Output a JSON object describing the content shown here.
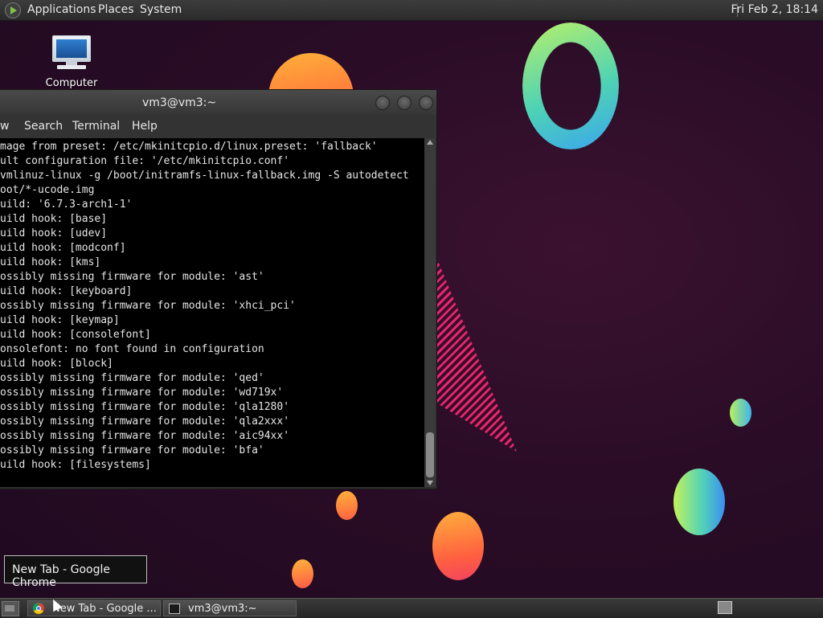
{
  "top_panel": {
    "menu": [
      "Applications",
      "Places",
      "System"
    ],
    "clock": "Fri Feb  2, 18:14"
  },
  "desktop": {
    "icons": [
      {
        "label": "Computer",
        "icon": "computer-monitor-icon"
      }
    ]
  },
  "terminal": {
    "title": "vm3@vm3:~",
    "menu": [
      "w",
      "Search",
      "Terminal",
      "Help"
    ],
    "lines": [
      "mage from preset: /etc/mkinitcpio.d/linux.preset: 'fallback'",
      "ult configuration file: '/etc/mkinitcpio.conf'",
      "vmlinuz-linux -g /boot/initramfs-linux-fallback.img -S autodetect",
      "oot/*-ucode.img",
      "uild: '6.7.3-arch1-1'",
      "uild hook: [base]",
      "uild hook: [udev]",
      "uild hook: [modconf]",
      "uild hook: [kms]",
      "ossibly missing firmware for module: 'ast'",
      "uild hook: [keyboard]",
      "ossibly missing firmware for module: 'xhci_pci'",
      "uild hook: [keymap]",
      "uild hook: [consolefont]",
      "onsolefont: no font found in configuration",
      "uild hook: [block]",
      "ossibly missing firmware for module: 'qed'",
      "ossibly missing firmware for module: 'wd719x'",
      "ossibly missing firmware for module: 'qla1280'",
      "ossibly missing firmware for module: 'qla2xxx'",
      "ossibly missing firmware for module: 'aic94xx'",
      "ossibly missing firmware for module: 'bfa'",
      "uild hook: [filesystems]"
    ]
  },
  "tooltip": "New Tab - Google Chrome",
  "taskbar": {
    "tasks": [
      {
        "label": "New Tab - Google ...",
        "icon": "chrome-icon"
      },
      {
        "label": "vm3@vm3:~",
        "icon": "terminal-icon"
      }
    ]
  },
  "colors": {
    "desktop_bg": "#2a0c26",
    "terminal_bg": "#000000",
    "terminal_fg": "#e6e6e6",
    "panel_bg": "#2e2e2e",
    "accent_pink": "#e8246a"
  }
}
